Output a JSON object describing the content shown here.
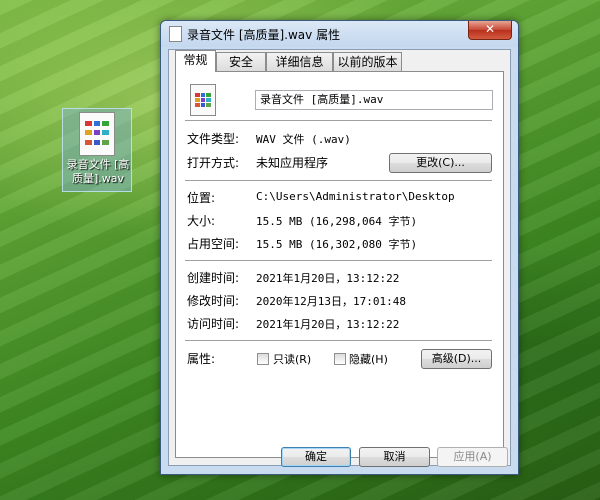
{
  "desktop": {
    "icon_label": "录音文件 [高质量].wav"
  },
  "window": {
    "title": "录音文件 [高质量].wav 属性",
    "close_glyph": "✕",
    "tabs": [
      {
        "label": "常规"
      },
      {
        "label": "安全"
      },
      {
        "label": "详细信息"
      },
      {
        "label": "以前的版本"
      }
    ],
    "active_tab": "常规"
  },
  "general": {
    "file_name": "录音文件 [高质量].wav",
    "file_type_label": "文件类型:",
    "file_type_value": "WAV 文件 (.wav)",
    "opens_with_label": "打开方式:",
    "opens_with_value": "未知应用程序",
    "change_button": "更改(C)...",
    "location_label": "位置:",
    "location_value": "C:\\Users\\Administrator\\Desktop",
    "size_label": "大小:",
    "size_value": "15.5 MB (16,298,064 字节)",
    "size_on_disk_label": "占用空间:",
    "size_on_disk_value": "15.5 MB (16,302,080 字节)",
    "created_label": "创建时间:",
    "created_value": "2021年1月20日，13:12:22",
    "modified_label": "修改时间:",
    "modified_value": "2020年12月13日，17:01:48",
    "accessed_label": "访问时间:",
    "accessed_value": "2021年1月20日，13:12:22",
    "attributes_label": "属性:",
    "readonly_label": "只读(R)",
    "readonly_checked": false,
    "hidden_label": "隐藏(H)",
    "hidden_checked": false,
    "advanced_button": "高级(D)..."
  },
  "footer": {
    "ok_button": "确定",
    "cancel_button": "取消",
    "apply_button": "应用(A)"
  },
  "icon_colors": [
    "#d93636",
    "#2f6fd6",
    "#36a336",
    "#e0a020",
    "#7a3fc4",
    "#2fb0c4",
    "#d6553a",
    "#3a58c8",
    "#5fa34a"
  ]
}
